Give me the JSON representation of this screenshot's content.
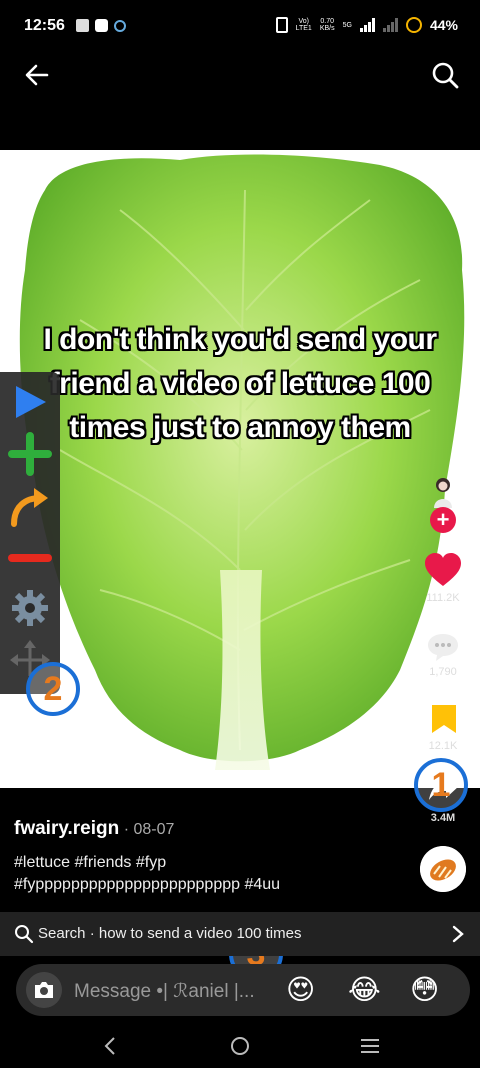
{
  "status_bar": {
    "time": "12:56",
    "network_line1": "Vo)",
    "network_line2": "LTE1",
    "speed_value": "0.70",
    "speed_unit": "KB/s",
    "net_type": "5G",
    "battery": "44%"
  },
  "header": {
    "back_icon": "arrow-left-icon",
    "search_icon": "search-icon"
  },
  "video": {
    "caption_lines": [
      "I don't think you'd send your",
      "friend a video of lettuce 100",
      "times just to annoy them"
    ]
  },
  "floating_toolbar": {
    "items": [
      "play-icon",
      "plus-icon",
      "redo-arrow-icon",
      "minus-icon",
      "settings-gear-icon",
      "move-arrows-icon"
    ]
  },
  "markers": {
    "m1": "1",
    "m2": "2",
    "m3": "3"
  },
  "rail": {
    "likes": "111.2K",
    "comments": "1,790",
    "saves": "12.1K",
    "shares": "3.4M",
    "follow_symbol": "+"
  },
  "post": {
    "author": "fwairy.reign",
    "date": "· 08-07",
    "tags_line1": "#lettuce #friends #fyp",
    "tags_line2": "#fyppppppppppppppppppppppp #4uu"
  },
  "search_suggestion": {
    "text": "Search · how to send a video 100 times"
  },
  "message_bar": {
    "placeholder": "Message •| ℛaniel |...",
    "emojis": [
      "😍",
      "😂",
      "😳"
    ]
  },
  "colors": {
    "like_red": "#e8194a",
    "save_yellow": "#ffc107",
    "marker_blue": "#1b6fd6",
    "marker_orange": "#e67a1e",
    "lettuce_green": "#8ccf3c"
  }
}
